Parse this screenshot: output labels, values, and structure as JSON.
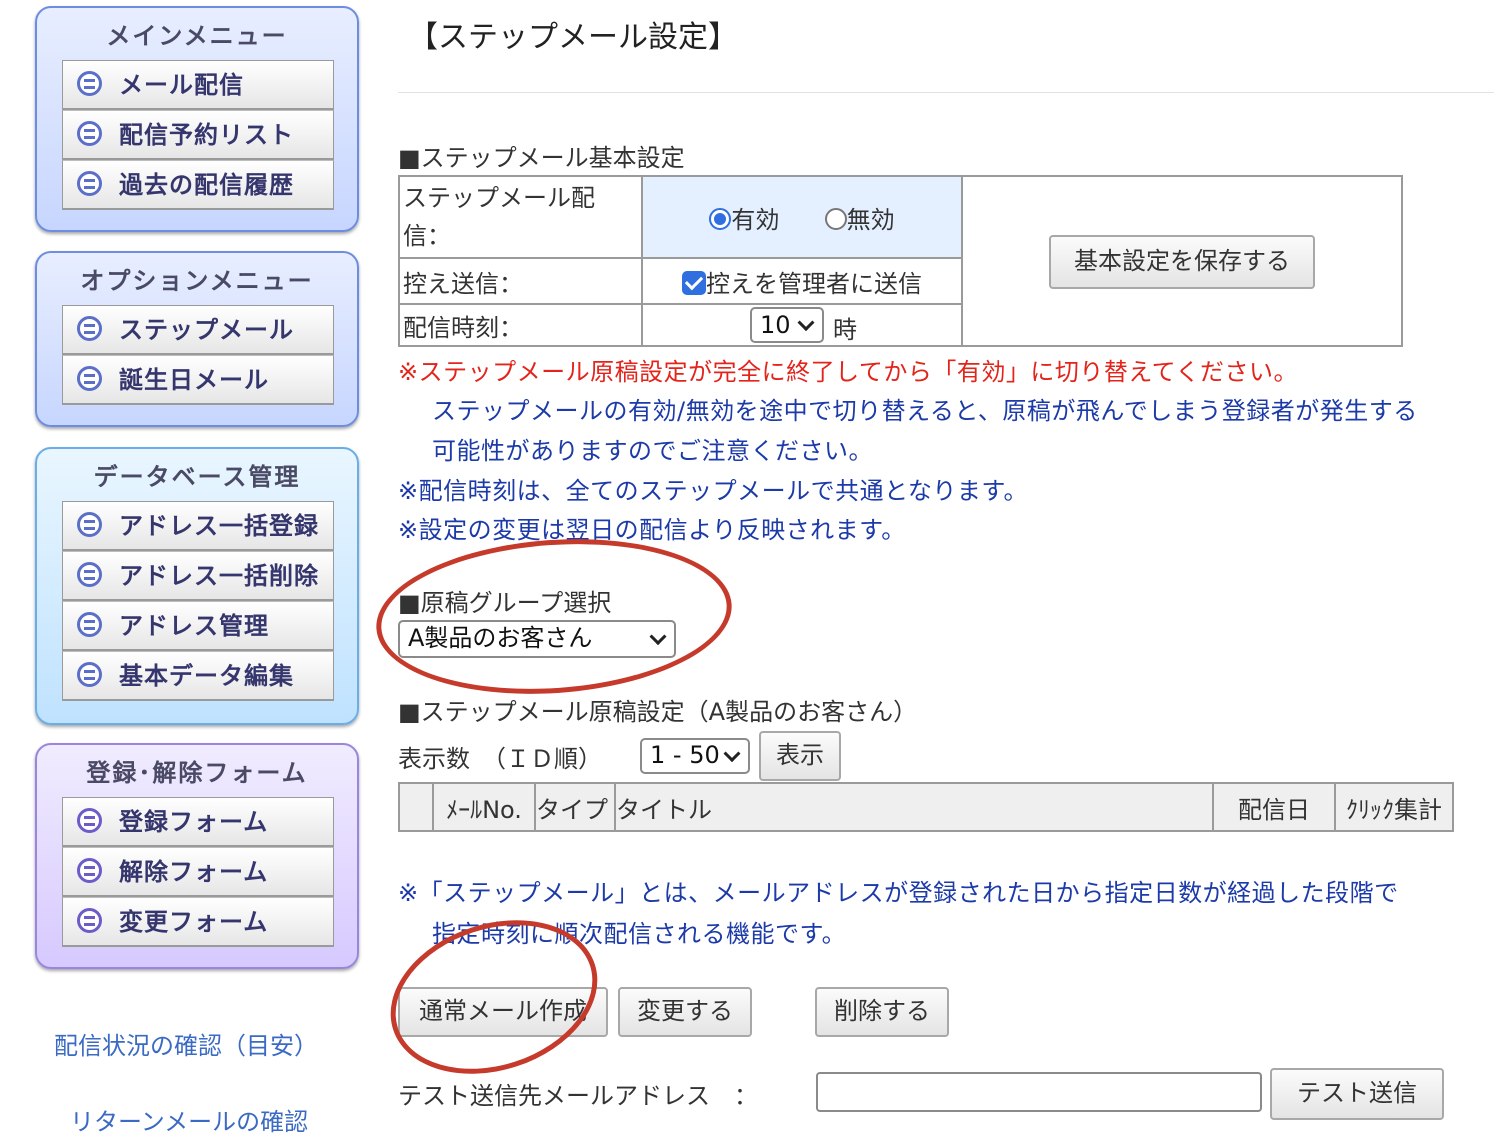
{
  "sidebar": {
    "main_menu": {
      "title": "メインメニュー",
      "items": [
        "メール配信",
        "配信予約リスト",
        "過去の配信履歴"
      ]
    },
    "option_menu": {
      "title": "オプションメニュー",
      "items": [
        "ステップメール",
        "誕生日メール"
      ]
    },
    "database_menu": {
      "title": "データベース管理",
      "items": [
        "アドレス一括登録",
        "アドレス一括削除",
        "アドレス管理",
        "基本データ編集"
      ]
    },
    "form_menu": {
      "title": "登録･解除フォーム",
      "items": [
        "登録フォーム",
        "解除フォーム",
        "変更フォーム"
      ]
    },
    "links": [
      "配信状況の確認（目安）",
      "リターンメールの確認"
    ],
    "colors": {
      "main": "#c7d6ff",
      "database": "#bfe2ff",
      "form": "#d6c9ff"
    }
  },
  "page": {
    "title": "【ステップメール設定】"
  },
  "basic_settings": {
    "heading": "■ステップメール基本設定",
    "delivery_label": "ステップメール配信：",
    "enabled_label": "有効",
    "disabled_label": "無効",
    "selected": "有効",
    "cc_label": "控え送信：",
    "cc_checkbox_label": "控えを管理者に送信",
    "cc_checked": true,
    "time_label": "配信時刻：",
    "time_value": "10",
    "time_unit": "時",
    "save_button": "基本設定を保存する"
  },
  "notes": {
    "warning_red": "※ステップメール原稿設定が完全に終了してから「有効」に切り替えてください。",
    "warning_blue_1": "ステップメールの有効/無効を途中で切り替えると、原稿が飛んでしまう登録者が発生する",
    "warning_blue_2": "可能性がありますのでご注意ください。",
    "time_note": "※配信時刻は、全てのステップメールで共通となります。",
    "change_note": "※設定の変更は翌日の配信より反映されます。"
  },
  "group": {
    "heading": "■原稿グループ選択",
    "selected": "A製品のお客さん"
  },
  "drafts": {
    "heading": "■ステップメール原稿設定（A製品のお客さん）",
    "display_count_label": "表示数　（ＩＤ順）",
    "range_value": "1 - 50",
    "display_button": "表示",
    "columns": [
      "",
      "ﾒｰﾙNo.",
      "タイプ",
      "タイトル",
      "配信日",
      "ｸﾘｯｸ集計"
    ]
  },
  "explanation": {
    "line1": "※「ステップメール」とは、メールアドレスが登録された日から指定日数が経過した段階で",
    "line2": "指定時刻に順次配信される機能です。"
  },
  "actions": {
    "create_button": "通常メール作成",
    "change_button": "変更する",
    "delete_button": "削除する"
  },
  "test_send": {
    "label": "テスト送信先メールアドレス　：",
    "value": "",
    "button": "テスト送信"
  },
  "accent": {
    "annotation_red": "#c63a2c",
    "link_blue": "#3b6ac4",
    "note_navy": "#1c3aa8",
    "note_red": "#e3241b"
  }
}
